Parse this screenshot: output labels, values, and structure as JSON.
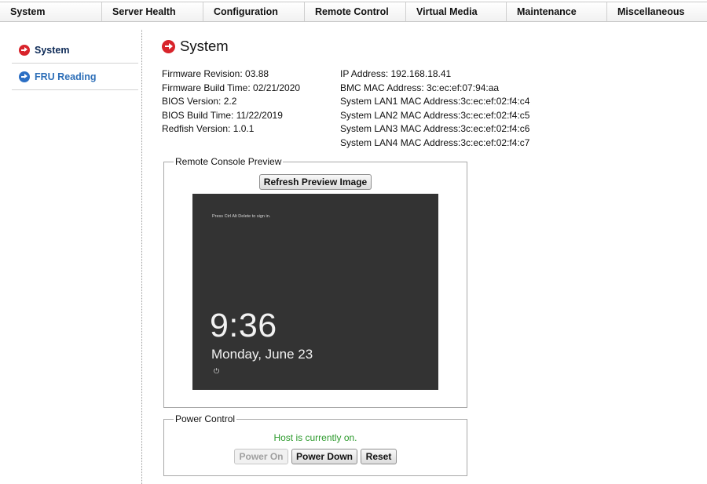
{
  "nav": {
    "items": [
      {
        "label": "System"
      },
      {
        "label": "Server Health"
      },
      {
        "label": "Configuration"
      },
      {
        "label": "Remote Control"
      },
      {
        "label": "Virtual Media"
      },
      {
        "label": "Maintenance"
      },
      {
        "label": "Miscellaneous"
      }
    ]
  },
  "sidebar": {
    "items": [
      {
        "label": "System",
        "icon": "red-arrow-icon",
        "active": true
      },
      {
        "label": "FRU Reading",
        "icon": "blue-arrow-icon",
        "active": false
      }
    ]
  },
  "page": {
    "title": "System"
  },
  "system_info": {
    "left": [
      "Firmware Revision:  03.88",
      "Firmware Build Time:  02/21/2020",
      "BIOS Version: 2.2",
      "BIOS Build Time: 11/22/2019",
      "Redfish Version: 1.0.1"
    ],
    "right": [
      "IP Address:  192.168.18.41",
      "BMC MAC Address:  3c:ec:ef:07:94:aa",
      "System LAN1 MAC Address:3c:ec:ef:02:f4:c4",
      "System LAN2 MAC Address:3c:ec:ef:02:f4:c5",
      "System LAN3 MAC Address:3c:ec:ef:02:f4:c6",
      "System LAN4 MAC Address:3c:ec:ef:02:f4:c7"
    ]
  },
  "console": {
    "legend": "Remote Console Preview",
    "refresh_label": "Refresh Preview Image",
    "preview": {
      "hint": "Press Ctrl  Alt  Delete to sign in.",
      "time": "9:36",
      "date": "Monday, June 23",
      "icon": "ease-of-access-icon"
    }
  },
  "power": {
    "legend": "Power Control",
    "status": "Host is currently on.",
    "status_color": "#2c9a2c",
    "power_on_label": "Power On",
    "power_down_label": "Power Down",
    "reset_label": "Reset"
  },
  "colors": {
    "active_arrow": "#d8242b",
    "inactive_arrow": "#2c6fc4",
    "sidebar_active_text": "#0d2a57",
    "sidebar_inactive_text": "#2e6fb8",
    "preview_background": "#333333"
  }
}
